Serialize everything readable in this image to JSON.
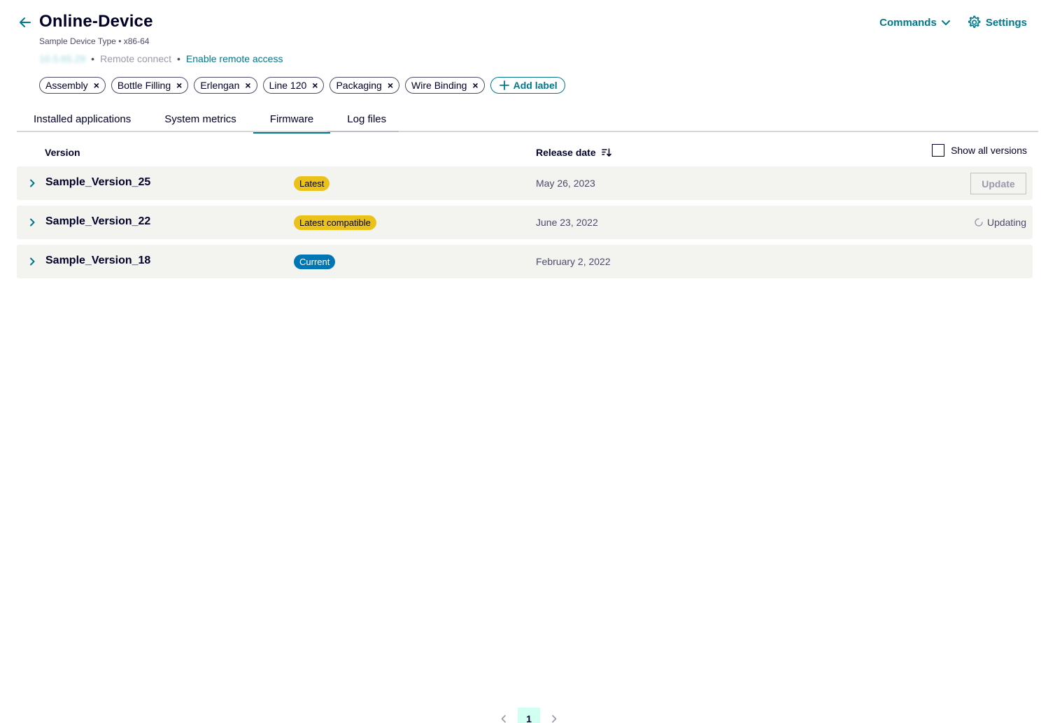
{
  "header": {
    "title": "Online-Device",
    "device_type": "Sample Device Type",
    "separator": "•",
    "architecture": "x86-64",
    "ip_address": "10.5.65.29",
    "remote_connect": "Remote connect",
    "enable_remote_access": "Enable remote access",
    "commands_label": "Commands",
    "settings_label": "Settings"
  },
  "labels": {
    "items": [
      "Assembly",
      "Bottle Filling",
      "Erlengan",
      "Line 120",
      "Packaging",
      "Wire Binding"
    ],
    "add_label": "Add label",
    "remove_glyph": "×"
  },
  "tabs": [
    {
      "label": "Installed applications",
      "active": false
    },
    {
      "label": "System metrics",
      "active": false
    },
    {
      "label": "Firmware",
      "active": true
    },
    {
      "label": "Log files",
      "active": false
    }
  ],
  "table": {
    "col_version": "Version",
    "col_release_date": "Release date",
    "show_all_versions": "Show all versions",
    "show_all_checked": false,
    "rows": [
      {
        "name": "Sample_Version_25",
        "badge": "Latest",
        "badge_color": "#ebc21a",
        "date": "May 26, 2023",
        "action": "Update"
      },
      {
        "name": "Sample_Version_22",
        "badge": "Latest compatible",
        "badge_color": "#ebc21a",
        "date": "June 23, 2022",
        "status": "Updating"
      },
      {
        "name": "Sample_Version_18",
        "badge": "Current",
        "badge_color": "#0076b4",
        "date": "February 2, 2022"
      }
    ]
  },
  "pagination": {
    "current_page": "1"
  },
  "colors": {
    "accent": "#00788a",
    "row_bg": "#f3f3f0",
    "badge_yellow": "#ebc21a",
    "badge_blue": "#0076b4",
    "page_active_bg": "#d1fff2"
  }
}
